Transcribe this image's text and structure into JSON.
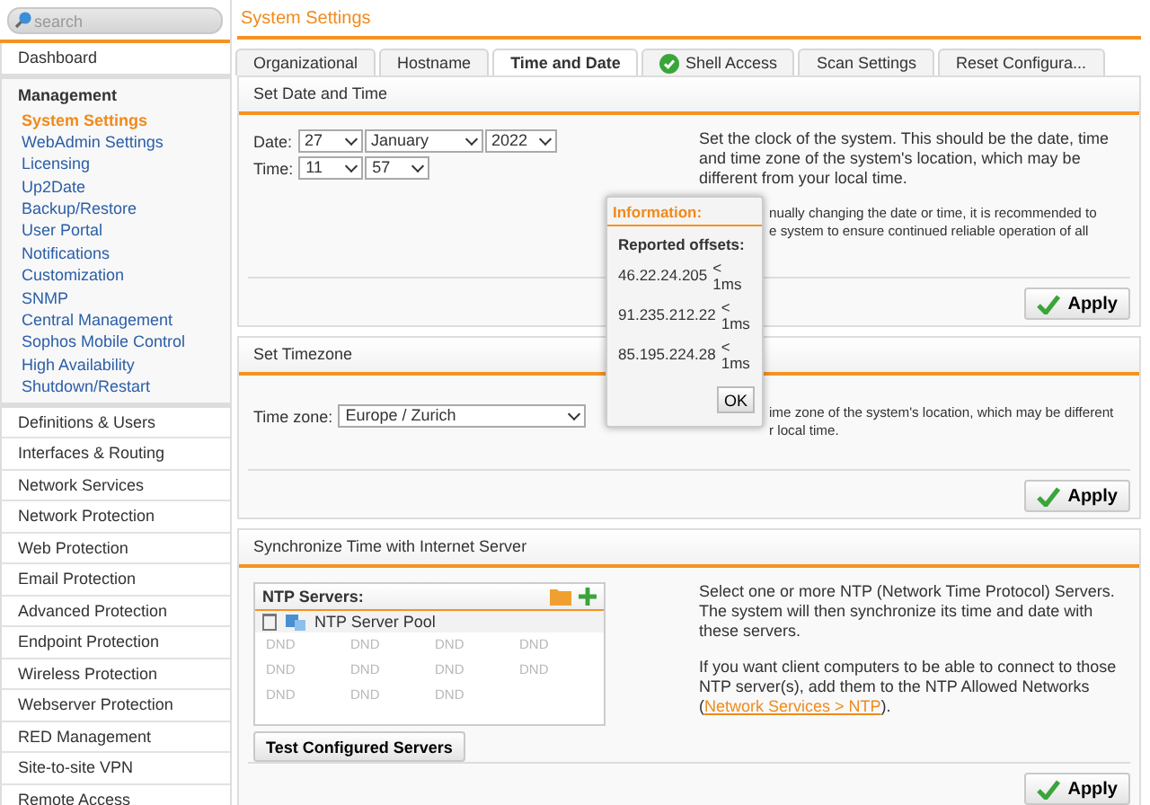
{
  "search": {
    "placeholder": "search"
  },
  "sidebar": {
    "items": [
      {
        "label": "Dashboard",
        "selected": false
      },
      {
        "label": "Management",
        "children": [
          {
            "label": "System Settings",
            "selected": true
          },
          {
            "label": "WebAdmin Settings",
            "selected": false
          },
          {
            "label": "Licensing",
            "selected": false
          },
          {
            "label": "Up2Date",
            "selected": false
          },
          {
            "label": "Backup/Restore",
            "selected": false
          },
          {
            "label": "User Portal",
            "selected": false
          },
          {
            "label": "Notifications",
            "selected": false
          },
          {
            "label": "Customization",
            "selected": false
          },
          {
            "label": "SNMP",
            "selected": false
          },
          {
            "label": "Central Management",
            "selected": false
          },
          {
            "label": "Sophos Mobile Control",
            "selected": false
          },
          {
            "label": "High Availability",
            "selected": false
          },
          {
            "label": "Shutdown/Restart",
            "selected": false
          }
        ]
      },
      {
        "label": "Definitions & Users",
        "selected": false
      },
      {
        "label": "Interfaces & Routing",
        "selected": false
      },
      {
        "label": "Network Services",
        "selected": false
      },
      {
        "label": "Network Protection",
        "selected": false
      },
      {
        "label": "Web Protection",
        "selected": false
      },
      {
        "label": "Email Protection",
        "selected": false
      },
      {
        "label": "Advanced Protection",
        "selected": false
      },
      {
        "label": "Endpoint Protection",
        "selected": false
      },
      {
        "label": "Wireless Protection",
        "selected": false
      },
      {
        "label": "Webserver Protection",
        "selected": false
      },
      {
        "label": "RED Management",
        "selected": false
      },
      {
        "label": "Site-to-site VPN",
        "selected": false
      },
      {
        "label": "Remote Access",
        "selected": false
      }
    ]
  },
  "page_title": "System Settings",
  "tabs": [
    {
      "label": "Organizational",
      "selected": false,
      "status": false
    },
    {
      "label": "Hostname",
      "selected": false,
      "status": false
    },
    {
      "label": "Time and Date",
      "selected": true,
      "status": false
    },
    {
      "label": "Shell Access",
      "selected": false,
      "status": true
    },
    {
      "label": "Scan Settings",
      "selected": false,
      "status": false
    },
    {
      "label": "Reset Configura...",
      "selected": false,
      "status": false
    }
  ],
  "date_panel": {
    "title": "Set Date and Time",
    "date_label": "Date:",
    "day": "27",
    "month": "January",
    "year": "2022",
    "time_label": "Time:",
    "hour": "11",
    "minute": "57",
    "help": [
      "Set the clock of the system. This should be the date, time and time zone of the system's location, which may be different from your local time."
    ],
    "help_covered": [
      "nually changing the date or time, it is recommended to",
      "e system to ensure continued reliable operation of all"
    ],
    "apply": "Apply"
  },
  "timezone_panel": {
    "title": "Set Timezone",
    "label": "Time zone:",
    "value": "Europe / Zurich",
    "help_covered": [
      "ime zone of the system's location, which may be different",
      "r local time."
    ],
    "apply": "Apply"
  },
  "ntp_panel": {
    "title": "Synchronize Time with Internet Server",
    "list_title": "NTP Servers:",
    "servers": [
      "NTP Server Pool"
    ],
    "drop_hints": [
      "DND",
      "DND",
      "DND",
      "DND",
      "DND",
      "DND",
      "DND",
      "DND",
      "DND",
      "DND",
      "DND"
    ],
    "test_button": "Test Configured Servers",
    "help": [
      "Select one or more NTP (Network Time Protocol) Servers. The system will then synchronize its time and date with these servers."
    ],
    "help2": "If you want client computers to be able to connect to those NTP server(s), add them to the NTP Allowed Networks (",
    "link": "Network Services > NTP",
    "help2_end": ").",
    "apply": "Apply"
  },
  "popup": {
    "title": "Information:",
    "heading": "Reported offsets:",
    "offsets": [
      {
        "host": "46.22.24.205",
        "lt": "<",
        "value": "1ms"
      },
      {
        "host": "91.235.212.22",
        "lt": "<",
        "value": "1ms"
      },
      {
        "host": "85.195.224.28",
        "lt": "<",
        "value": "1ms"
      }
    ],
    "ok": "OK"
  }
}
